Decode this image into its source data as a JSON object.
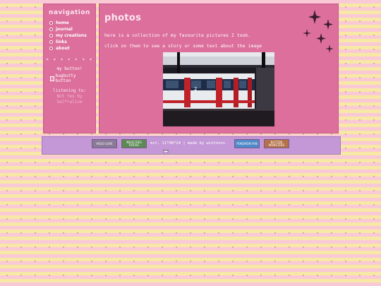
{
  "sidebar": {
    "title": "navigation",
    "items": [
      {
        "label": "home",
        "icon": "house-icon"
      },
      {
        "label": "journal",
        "icon": "book-icon"
      },
      {
        "label": "my creations",
        "icon": "palette-icon"
      },
      {
        "label": "links",
        "icon": "link-icon"
      },
      {
        "label": "about",
        "icon": "heart-icon"
      }
    ],
    "stars": "* * * * * * *",
    "button_caption": "my button!",
    "button_alt": "bugbutty button",
    "listening_label": "listening to:",
    "song": "Not Yes by",
    "artist": "half•alive"
  },
  "main": {
    "title": "photos",
    "intro": "here is a collection of my favourite pictures I took.",
    "hint": "click on them to see a story or some text about the image"
  },
  "footer": {
    "text": "est. 11*08*24 | made by wiztnovo",
    "badges": [
      "HOLO LOVE",
      "NEOCITIES ROCKS",
      "POKEMON FAN",
      "BUTTON MONSTERS"
    ]
  },
  "colors": {
    "panel": "#dc6f9b",
    "footer": "#c498d6",
    "stripe_pink": "#f9c9d6",
    "stripe_yellow": "#f7e8a6"
  }
}
